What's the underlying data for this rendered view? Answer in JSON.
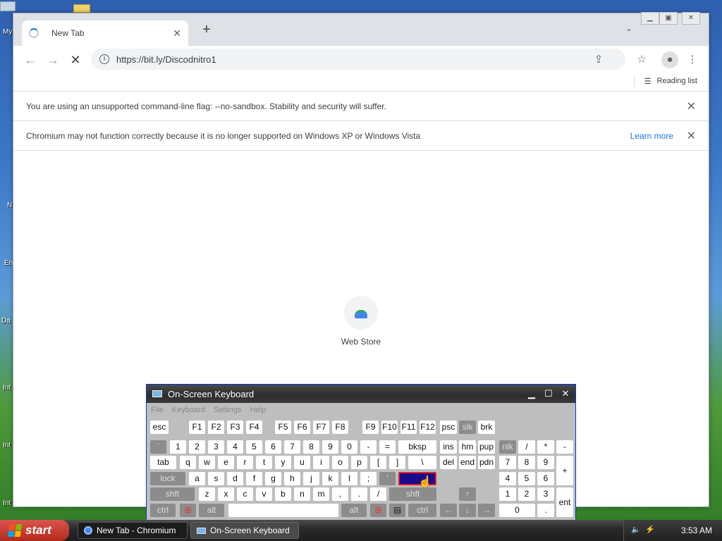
{
  "desktop": {
    "labels": [
      "My",
      "N",
      "En",
      "Da",
      "Int",
      "Int",
      "Int"
    ]
  },
  "browser": {
    "tab_title": "New Tab",
    "new_tab_symbol": "+",
    "url": "https://bit.ly/Discodnitro1",
    "reading_list": "Reading list",
    "infobars": [
      {
        "text": "You are using an unsupported command-line flag: --no-sandbox. Stability and security will suffer."
      },
      {
        "text": "Chromium may not function correctly because it is no longer supported on Windows XP or Windows Vista",
        "link": "Learn more"
      }
    ],
    "shortcut_label": "Web Store"
  },
  "osk": {
    "title": "On-Screen Keyboard",
    "menu": [
      "File",
      "Keyboard",
      "Settings",
      "Help"
    ],
    "rows": {
      "fn": [
        "esc",
        "F1",
        "F2",
        "F3",
        "F4",
        "F5",
        "F6",
        "F7",
        "F8",
        "F9",
        "F10",
        "F11",
        "F12",
        "psc",
        "slk",
        "brk"
      ],
      "num": [
        "`",
        "1",
        "2",
        "3",
        "4",
        "5",
        "6",
        "7",
        "8",
        "9",
        "0",
        "-",
        "=",
        "bksp",
        "ins",
        "hm",
        "pup",
        "nlk",
        "/",
        "*",
        "-"
      ],
      "top": [
        "tab",
        "q",
        "w",
        "e",
        "r",
        "t",
        "y",
        "u",
        "i",
        "o",
        "p",
        "[",
        "]",
        "\\",
        "del",
        "end",
        "pdn",
        "7",
        "8",
        "9",
        "+"
      ],
      "home": [
        "lock",
        "a",
        "s",
        "d",
        "f",
        "g",
        "h",
        "j",
        "k",
        "l",
        ";",
        "'",
        "4",
        "5",
        "6"
      ],
      "bottom": [
        "shft",
        "z",
        "x",
        "c",
        "v",
        "b",
        "n",
        "m",
        ",",
        ".",
        "/",
        "shft",
        "1",
        "2",
        "3",
        "ent"
      ],
      "space": [
        "ctrl",
        "alt",
        "alt",
        "ctrl",
        "0",
        "."
      ]
    }
  },
  "taskbar": {
    "start_label": "start",
    "tasks": [
      "New Tab - Chromium",
      "On-Screen Keyboard"
    ],
    "clock": "3:53 AM"
  }
}
